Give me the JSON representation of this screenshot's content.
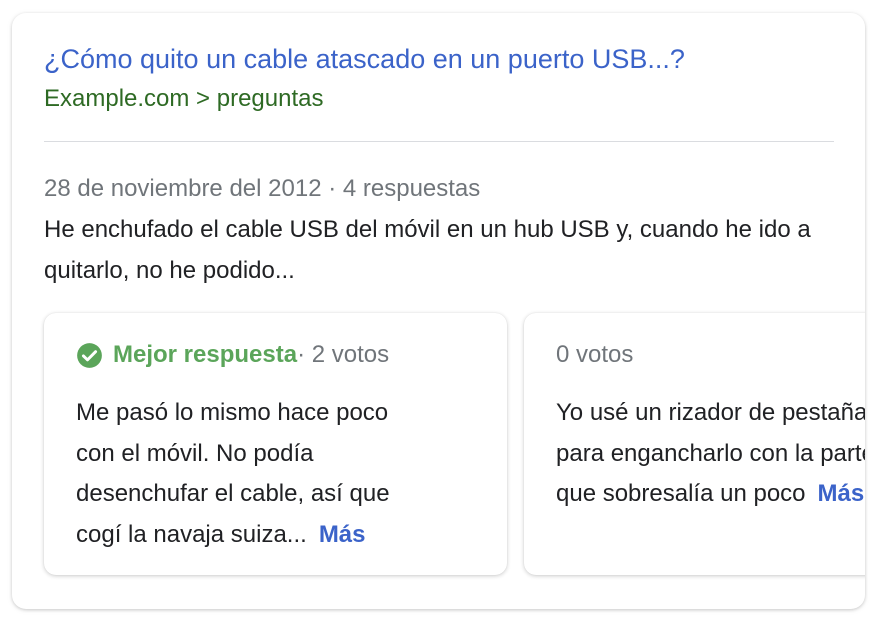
{
  "result": {
    "title": "¿Cómo quito un cable atascado en un puerto USB...?",
    "breadcrumb": "Example.com > preguntas",
    "meta": "28 de noviembre del 2012 · 4 respuestas",
    "snippet": "He enchufado el cable USB del móvil en un hub USB y, cuando he ido a quitarlo, no he podido..."
  },
  "answers": [
    {
      "best_label": "Mejor respuesta",
      "votes": " · 2 votos",
      "lines": [
        "Me pasó lo mismo hace poco",
        "con el móvil. No podía",
        "desenchufar el cable, así que",
        "cogí la navaja suiza..."
      ],
      "more": "Más"
    },
    {
      "votes": "0 votos",
      "lines": [
        "Yo usé un rizador de pestañas",
        "para engancharlo con la parte",
        "que sobresalía un poco"
      ],
      "more": "Más"
    }
  ],
  "colors": {
    "link": "#3b63c9",
    "breadcrumb": "#2e6a24",
    "best_answer": "#5ba55a",
    "muted": "#70757a",
    "text": "#202124"
  },
  "icons": {
    "best_answer": "check-circle-icon"
  }
}
